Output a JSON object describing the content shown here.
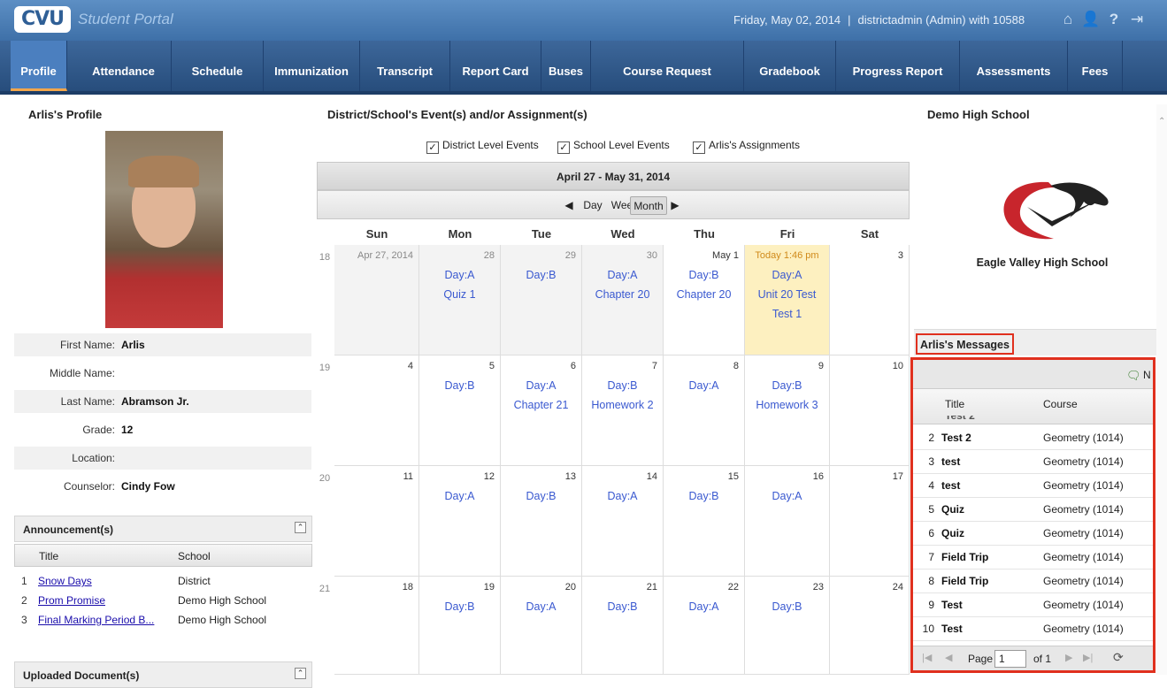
{
  "header": {
    "logo_text": "CVU",
    "portal_title": "Student Portal",
    "date_text": "Friday, May 02, 2014",
    "user_text": "districtadmin (Admin) with 10588"
  },
  "nav": {
    "tabs": [
      "Profile",
      "Attendance",
      "Schedule",
      "Immunization",
      "Transcript",
      "Report Card",
      "Buses",
      "Course Request",
      "Gradebook",
      "Progress Report",
      "Assessments",
      "Fees"
    ],
    "active": "Profile"
  },
  "profile": {
    "heading": "Arlis's Profile",
    "fields": [
      {
        "label": "First Name:",
        "value": "Arlis"
      },
      {
        "label": "Middle Name:",
        "value": ""
      },
      {
        "label": "Last Name:",
        "value": "Abramson Jr."
      },
      {
        "label": "Grade:",
        "value": "12"
      },
      {
        "label": "Location:",
        "value": ""
      },
      {
        "label": "Counselor:",
        "value": "Cindy Fow"
      }
    ]
  },
  "announcements": {
    "heading": "Announcement(s)",
    "columns": [
      "Title",
      "School"
    ],
    "rows": [
      {
        "n": "1",
        "title": "Snow Days",
        "school": "District"
      },
      {
        "n": "2",
        "title": "Prom Promise",
        "school": "Demo High School"
      },
      {
        "n": "3",
        "title": "Final Marking Period B...",
        "school": "Demo High School"
      }
    ]
  },
  "uploaded": {
    "heading": "Uploaded Document(s)"
  },
  "calendar": {
    "heading": "District/School's Event(s) and/or Assignment(s)",
    "filters": [
      "District Level Events",
      "School Level Events",
      "Arlis's Assignments"
    ],
    "range": "April 27 - May 31, 2014",
    "views": [
      "Day",
      "Week",
      "Month"
    ],
    "selected_view": "Month",
    "days": [
      "Sun",
      "Mon",
      "Tue",
      "Wed",
      "Thu",
      "Fri",
      "Sat"
    ],
    "weeks": [
      {
        "wk": "18",
        "cells": [
          {
            "d": "Apr 27, 2014",
            "ev": [],
            "state": "grey"
          },
          {
            "d": "28",
            "ev": [
              "Day:A",
              "Quiz 1"
            ],
            "state": "grey"
          },
          {
            "d": "29",
            "ev": [
              "Day:B"
            ],
            "state": "grey"
          },
          {
            "d": "30",
            "ev": [
              "Day:A",
              "Chapter 20"
            ],
            "state": "grey"
          },
          {
            "d": "May 1",
            "ev": [
              "Day:B",
              "Chapter 20"
            ],
            "state": "cur"
          },
          {
            "d": "Today 1:46 pm",
            "ev": [
              "Day:A",
              "Unit 20 Test",
              "Test 1"
            ],
            "state": "today"
          },
          {
            "d": "3",
            "ev": [],
            "state": "cur"
          }
        ]
      },
      {
        "wk": "19",
        "cells": [
          {
            "d": "4",
            "ev": [],
            "state": "cur"
          },
          {
            "d": "5",
            "ev": [
              "Day:B"
            ],
            "state": "cur"
          },
          {
            "d": "6",
            "ev": [
              "Day:A",
              "Chapter 21"
            ],
            "state": "cur"
          },
          {
            "d": "7",
            "ev": [
              "Day:B",
              "Homework 2"
            ],
            "state": "cur"
          },
          {
            "d": "8",
            "ev": [
              "Day:A"
            ],
            "state": "cur"
          },
          {
            "d": "9",
            "ev": [
              "Day:B",
              "Homework 3"
            ],
            "state": "cur"
          },
          {
            "d": "10",
            "ev": [],
            "state": "cur"
          }
        ]
      },
      {
        "wk": "20",
        "cells": [
          {
            "d": "11",
            "ev": [],
            "state": "cur"
          },
          {
            "d": "12",
            "ev": [
              "Day:A"
            ],
            "state": "cur"
          },
          {
            "d": "13",
            "ev": [
              "Day:B"
            ],
            "state": "cur"
          },
          {
            "d": "14",
            "ev": [
              "Day:A"
            ],
            "state": "cur"
          },
          {
            "d": "15",
            "ev": [
              "Day:B"
            ],
            "state": "cur"
          },
          {
            "d": "16",
            "ev": [
              "Day:A"
            ],
            "state": "cur"
          },
          {
            "d": "17",
            "ev": [],
            "state": "cur"
          }
        ]
      },
      {
        "wk": "21",
        "cells": [
          {
            "d": "18",
            "ev": [],
            "state": "cur"
          },
          {
            "d": "19",
            "ev": [
              "Day:B"
            ],
            "state": "cur"
          },
          {
            "d": "20",
            "ev": [
              "Day:A"
            ],
            "state": "cur"
          },
          {
            "d": "21",
            "ev": [
              "Day:B"
            ],
            "state": "cur"
          },
          {
            "d": "22",
            "ev": [
              "Day:A"
            ],
            "state": "cur"
          },
          {
            "d": "23",
            "ev": [
              "Day:B"
            ],
            "state": "cur"
          },
          {
            "d": "24",
            "ev": [],
            "state": "cur"
          }
        ]
      }
    ]
  },
  "school": {
    "heading": "Demo High School",
    "name": "Eagle Valley High School",
    "logo_colors": {
      "ring": "#c8252c",
      "bird": "#222222"
    }
  },
  "messages": {
    "heading": "Arlis's Messages",
    "new_label": "N",
    "columns": [
      "Title",
      "Course"
    ],
    "rows": [
      {
        "n": "2",
        "title": "Test 2",
        "course": "Geometry (1014)"
      },
      {
        "n": "3",
        "title": "test",
        "course": "Geometry (1014)"
      },
      {
        "n": "4",
        "title": "test",
        "course": "Geometry (1014)"
      },
      {
        "n": "5",
        "title": "Quiz",
        "course": "Geometry (1014)"
      },
      {
        "n": "6",
        "title": "Quiz",
        "course": "Geometry (1014)"
      },
      {
        "n": "7",
        "title": "Field Trip",
        "course": "Geometry (1014)"
      },
      {
        "n": "8",
        "title": "Field Trip",
        "course": "Geometry (1014)"
      },
      {
        "n": "9",
        "title": "Test",
        "course": "Geometry (1014)"
      },
      {
        "n": "10",
        "title": "Test",
        "course": "Geometry (1014)"
      }
    ],
    "pager": {
      "page_label": "Page",
      "page": "1",
      "of_label": "of 1"
    }
  },
  "icons": [
    "home-icon",
    "user-icon",
    "help-icon",
    "logout-icon",
    "checkbox-icon",
    "prev-arrow-icon",
    "next-arrow-icon",
    "collapse-icon",
    "new-message-icon",
    "first-page-icon",
    "prev-page-icon",
    "next-page-icon",
    "last-page-icon",
    "refresh-icon"
  ],
  "colors": {
    "header": "#4a7db5",
    "nav": "#2f5989",
    "highlight": "#e0301e",
    "today": "#fdf0c0",
    "event_link": "#3a59d0"
  }
}
